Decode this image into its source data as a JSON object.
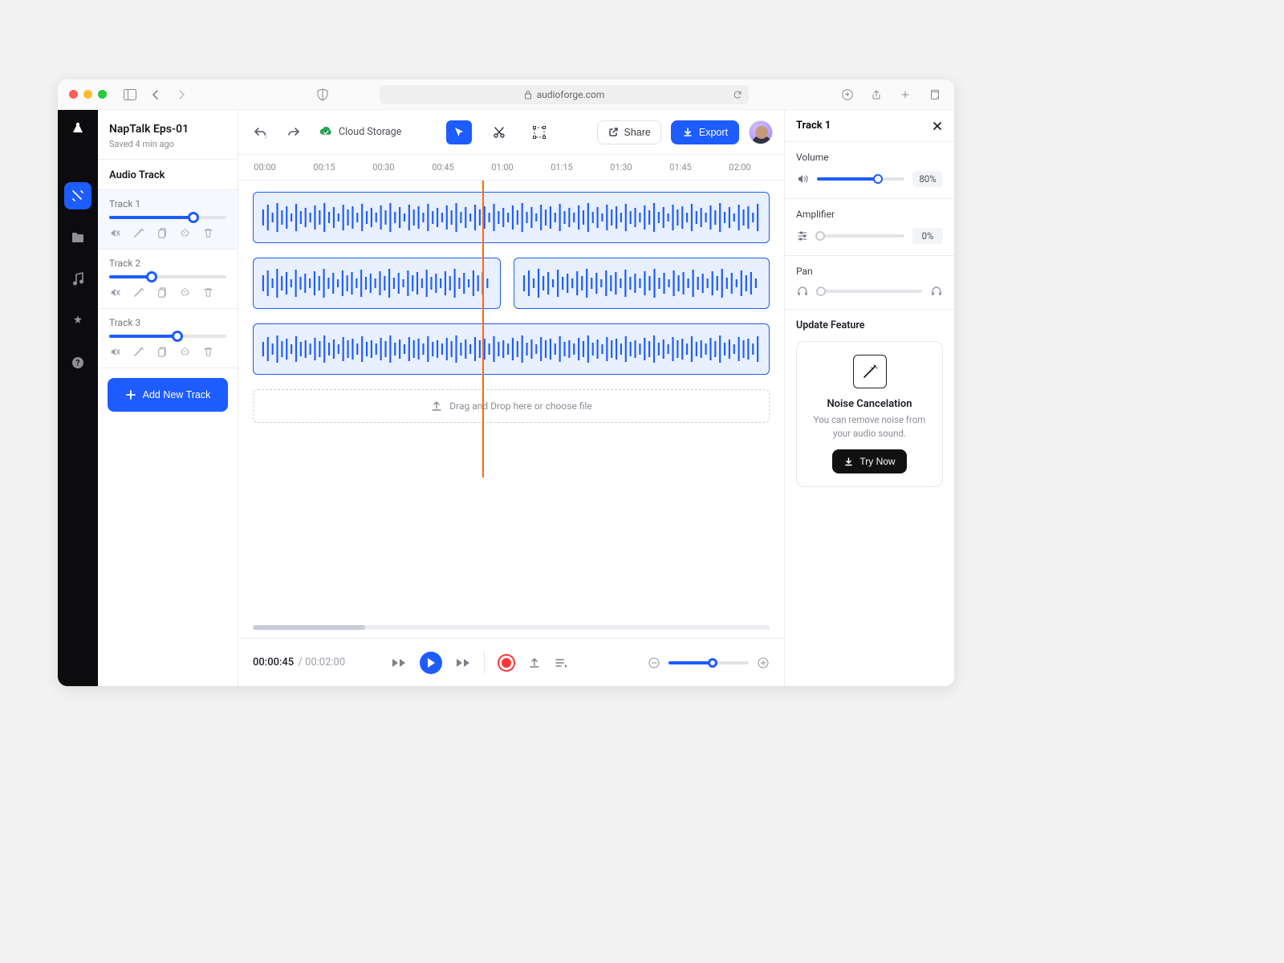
{
  "browser": {
    "url_domain": "audioforge.com"
  },
  "project": {
    "title": "NapTalk Eps-01",
    "saved_status": "Saved 4 min ago",
    "cloud_label": "Cloud Storage"
  },
  "toolbar": {
    "share_label": "Share",
    "export_label": "Export"
  },
  "left_panel": {
    "section_label": "Audio Track",
    "tracks": [
      {
        "name": "Track 1",
        "level_pct": 72,
        "selected": true
      },
      {
        "name": "Track 2",
        "level_pct": 36,
        "selected": false
      },
      {
        "name": "Track 3",
        "level_pct": 58,
        "selected": false
      }
    ],
    "add_track_label": "Add New Track"
  },
  "ruler": [
    "00:00",
    "00:15",
    "00:30",
    "00:45",
    "01:00",
    "01:15",
    "01:30",
    "01:45",
    "02:00"
  ],
  "playhead_pct": 42,
  "dropzone_label": "Drag and Drop here or choose file",
  "transport": {
    "current": "00:00:45",
    "total": "00:02:00",
    "zoom_pct": 55
  },
  "inspector": {
    "title": "Track 1",
    "volume": {
      "label": "Volume",
      "pct": 70,
      "display": "80%"
    },
    "amplifier": {
      "label": "Amplifier",
      "pct": 0,
      "display": "0%"
    },
    "pan": {
      "label": "Pan",
      "pct": 2
    },
    "update_label": "Update Feature",
    "feature": {
      "title": "Noise Cancelation",
      "desc": "You can remove noise from your audio sound.",
      "cta": "Try Now"
    }
  }
}
